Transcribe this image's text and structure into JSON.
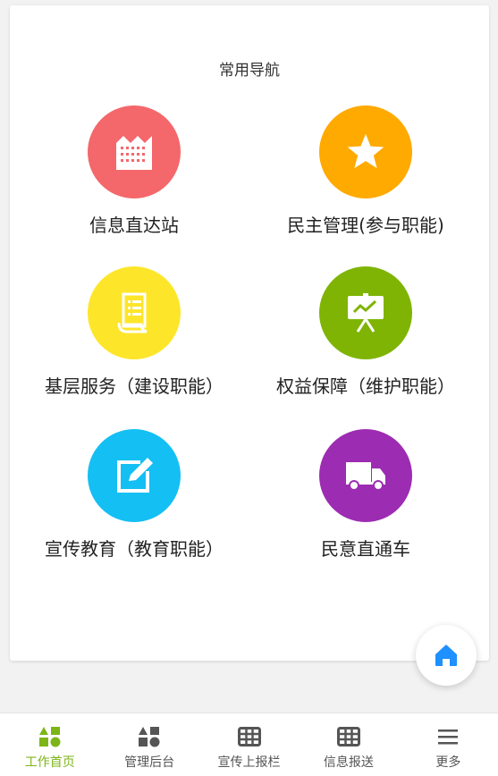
{
  "nav_section": {
    "title": "常用导航",
    "items": [
      {
        "label": "信息直达站",
        "color": "#f4676b",
        "icon": "building-icon"
      },
      {
        "label": "民主管理(参与职能)",
        "color": "#ffaa00",
        "icon": "star-icon"
      },
      {
        "label": "基层服务（建设职能）",
        "color": "#fde62a",
        "icon": "document-icon"
      },
      {
        "label": "权益保障（维护职能）",
        "color": "#7fb405",
        "icon": "presentation-chart-icon"
      },
      {
        "label": "宣传教育（教育职能）",
        "color": "#14bff4",
        "icon": "edit-icon"
      },
      {
        "label": "民意直通车",
        "color": "#9c2cb1",
        "icon": "truck-icon"
      }
    ]
  },
  "fab": {
    "icon": "home-icon",
    "color": "#1e90ff"
  },
  "tabbar": {
    "active_color": "#7db518",
    "inactive_color": "#555555",
    "items": [
      {
        "label": "工作首页",
        "icon": "shapes-icon",
        "active": true
      },
      {
        "label": "管理后台",
        "icon": "shapes-icon",
        "active": false
      },
      {
        "label": "宣传上报栏",
        "icon": "grid-icon",
        "active": false
      },
      {
        "label": "信息报送",
        "icon": "grid-icon",
        "active": false
      },
      {
        "label": "更多",
        "icon": "menu-icon",
        "active": false
      }
    ]
  }
}
